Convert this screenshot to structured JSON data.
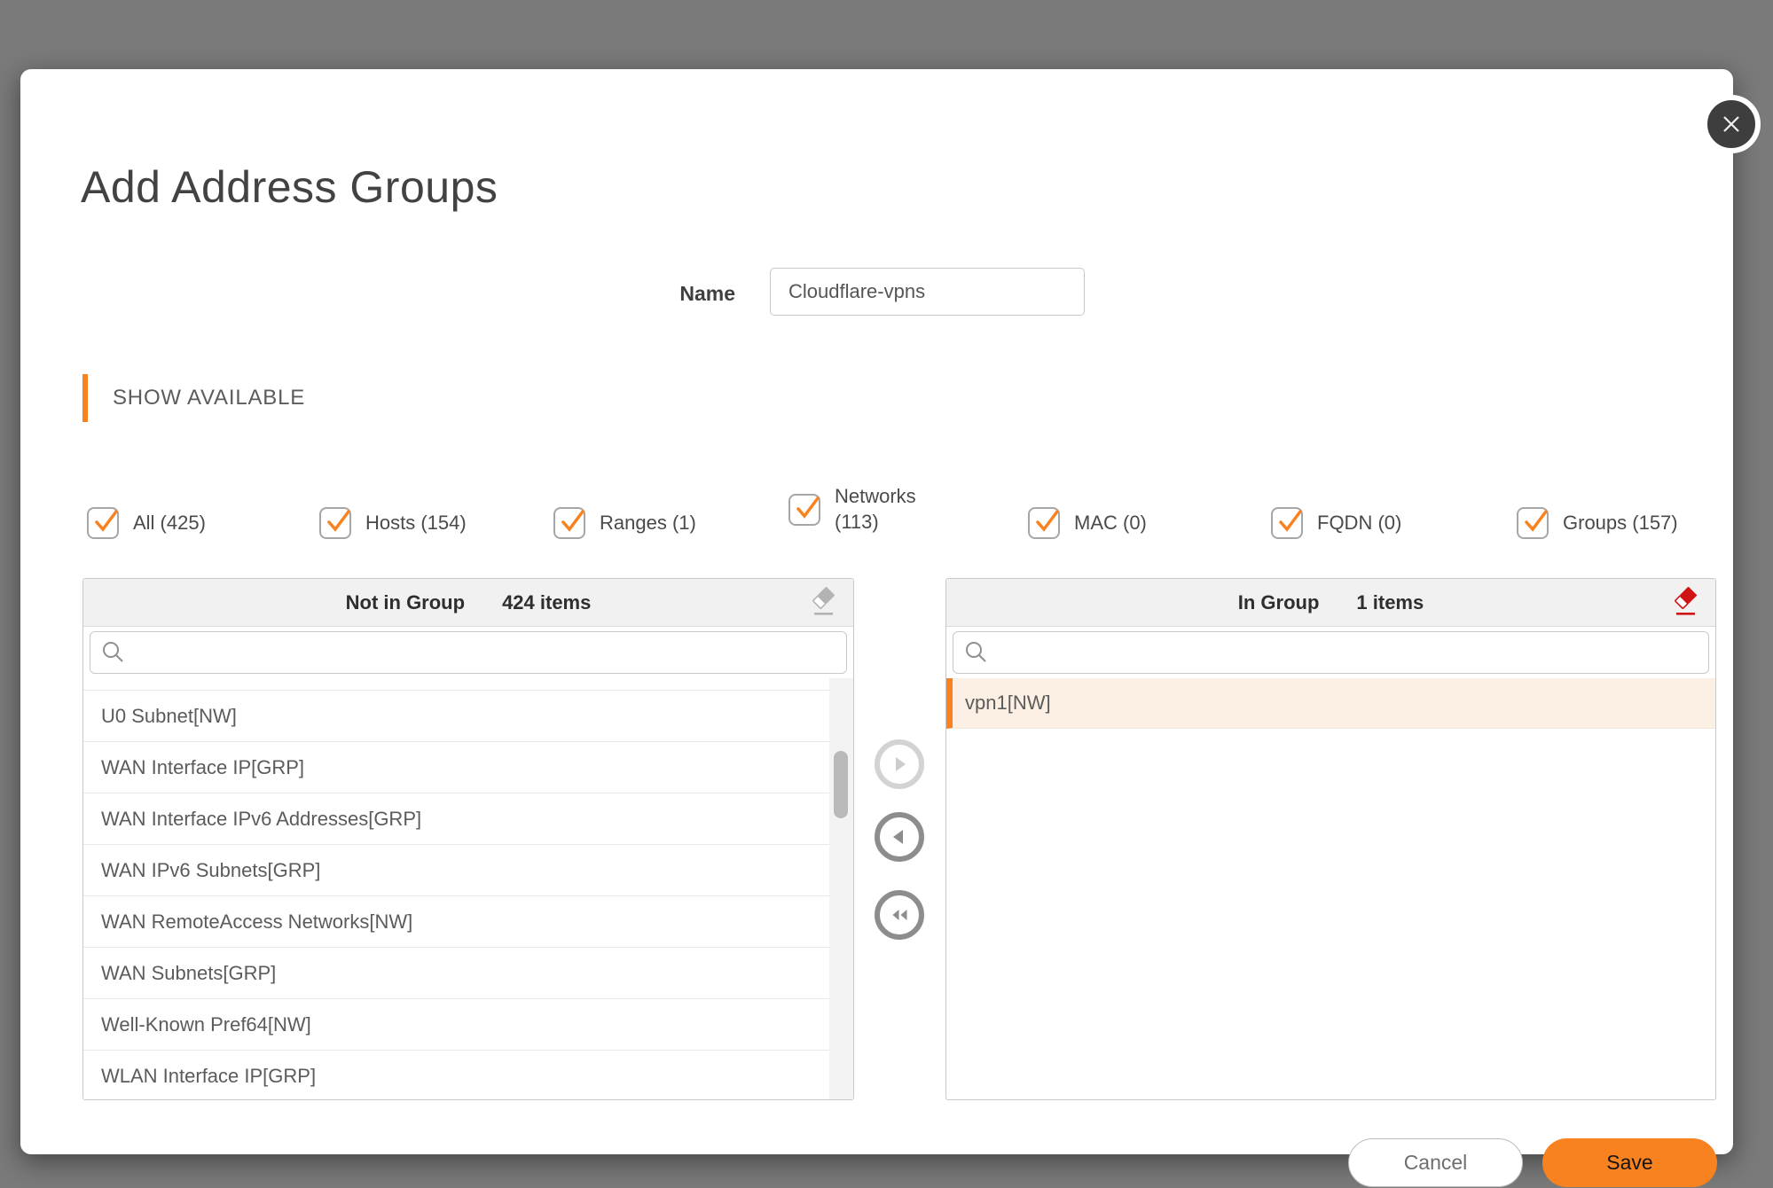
{
  "modal": {
    "title": "Add Address Groups"
  },
  "name_field": {
    "label": "Name",
    "value": "Cloudflare-vpns"
  },
  "section_header": {
    "label": "SHOW AVAILABLE"
  },
  "filters": [
    {
      "label": "All (425)",
      "checked": true
    },
    {
      "label": "Hosts (154)",
      "checked": true
    },
    {
      "label": "Ranges (1)",
      "checked": true
    },
    {
      "label": "Networks (113)",
      "checked": true
    },
    {
      "label": "MAC (0)",
      "checked": true
    },
    {
      "label": "FQDN (0)",
      "checked": true
    },
    {
      "label": "Groups (157)",
      "checked": true
    }
  ],
  "left_panel": {
    "title": "Not in Group",
    "count": "424 items",
    "search": {
      "placeholder": "",
      "value": ""
    },
    "items": [
      "U0 Subnet[NW]",
      "WAN Interface IP[GRP]",
      "WAN Interface IPv6 Addresses[GRP]",
      "WAN IPv6 Subnets[GRP]",
      "WAN RemoteAccess Networks[NW]",
      "WAN Subnets[GRP]",
      "Well-Known Pref64[NW]",
      "WLAN Interface IP[GRP]"
    ]
  },
  "right_panel": {
    "title": "In Group",
    "count": "1 items",
    "search": {
      "placeholder": "",
      "value": ""
    },
    "items": [
      "vpn1[NW]"
    ]
  },
  "footer": {
    "cancel_label": "Cancel",
    "save_label": "Save"
  },
  "icons": {
    "close": "x",
    "search": "magnifier",
    "erase_not_in_group": "eraser",
    "erase_in_group": "eraser-red",
    "move_right": "arrow-right",
    "move_left": "arrow-left",
    "move_all_left": "double-arrow-left"
  },
  "colors": {
    "accent": "#F8821F",
    "eraser_red": "#D01414",
    "backdrop": "#7A7A7A",
    "selected_row_bg": "#FCEFE3"
  }
}
